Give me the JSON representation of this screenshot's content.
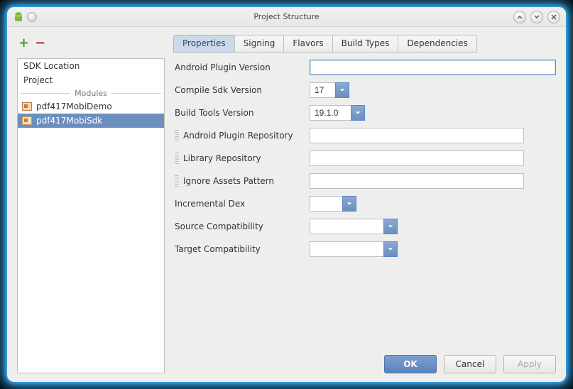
{
  "window": {
    "title": "Project Structure"
  },
  "sidebar_toolbar": {
    "add": "+",
    "remove": "−"
  },
  "tabs": [
    {
      "label": "Properties",
      "active": true
    },
    {
      "label": "Signing",
      "active": false
    },
    {
      "label": "Flavors",
      "active": false
    },
    {
      "label": "Build Types",
      "active": false
    },
    {
      "label": "Dependencies",
      "active": false
    }
  ],
  "sidebar": {
    "top_items": [
      "SDK Location",
      "Project"
    ],
    "modules_header": "Modules",
    "modules": [
      {
        "label": "pdf417MobiDemo",
        "selected": false
      },
      {
        "label": "pdf417MobiSdk",
        "selected": true
      }
    ]
  },
  "form": {
    "android_plugin_version": {
      "label": "Android Plugin Version",
      "value": ""
    },
    "compile_sdk_version": {
      "label": "Compile Sdk Version",
      "value": "17"
    },
    "build_tools_version": {
      "label": "Build Tools Version",
      "value": "19.1.0"
    },
    "android_plugin_repo": {
      "label": "Android Plugin Repository",
      "value": ""
    },
    "library_repository": {
      "label": "Library Repository",
      "value": ""
    },
    "ignore_assets_pattern": {
      "label": "Ignore Assets Pattern",
      "value": ""
    },
    "incremental_dex": {
      "label": "Incremental Dex",
      "value": ""
    },
    "source_compatibility": {
      "label": "Source Compatibility",
      "value": ""
    },
    "target_compatibility": {
      "label": "Target Compatibility",
      "value": ""
    }
  },
  "buttons": {
    "ok": "OK",
    "cancel": "Cancel",
    "apply": "Apply"
  }
}
